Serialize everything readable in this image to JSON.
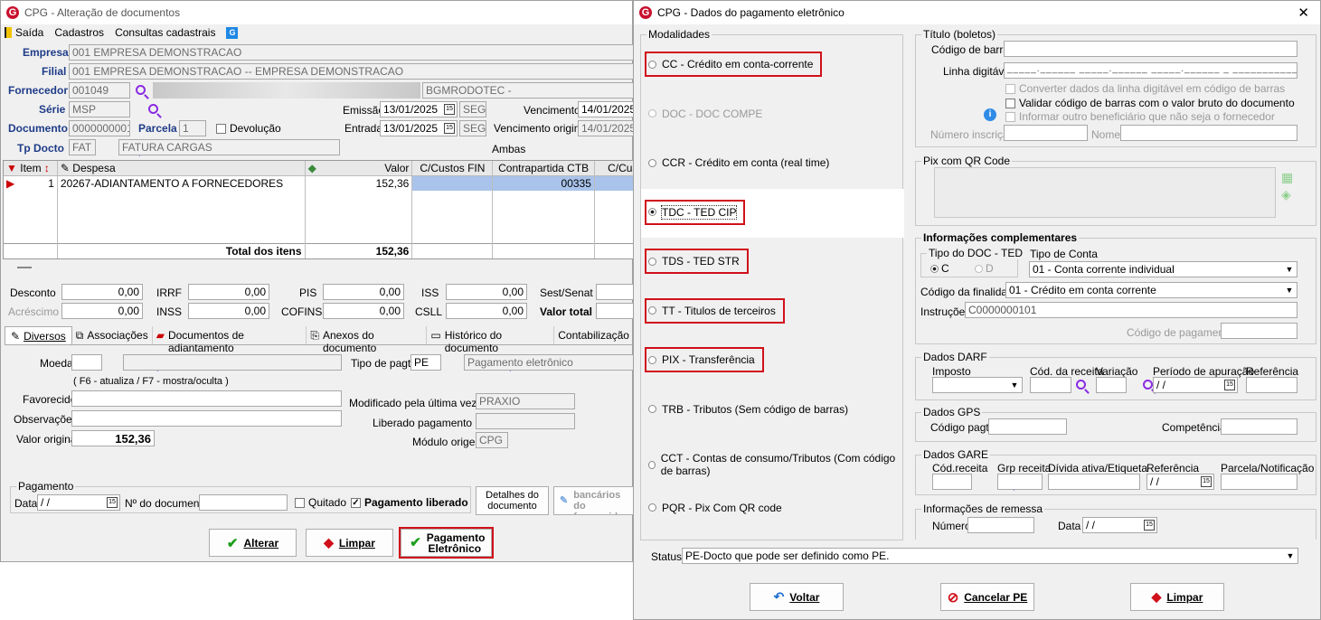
{
  "left": {
    "title": "CPG - Alteração de documentos",
    "menu": [
      "Saída",
      "Cadastros",
      "Consultas cadastrais"
    ],
    "empresa_label": "Empresa",
    "empresa": "001 EMPRESA DEMONSTRACAO",
    "filial_label": "Filial",
    "filial": "001 EMPRESA DEMONSTRACAO -- EMPRESA DEMONSTRACAO",
    "fornecedor_label": "Fornecedor",
    "fornecedor": "001049",
    "fornecedor_nome": "BGMRODOTEC -",
    "serie_label": "Série",
    "serie": "MSP",
    "emissao_label": "Emissão",
    "emissao": "13/01/2025",
    "emissao_dia": "SEG",
    "vencimento_label": "Vencimento",
    "vencimento": "14/01/2025",
    "documento_label": "Documento",
    "documento": "0000000001",
    "parcela_label": "Parcela",
    "parcela": "1",
    "devolucao_label": "Devolução",
    "entrada_label": "Entrada",
    "entrada": "13/01/2025",
    "entrada_dia": "SEG",
    "venc_original_label": "Vencimento original",
    "venc_original": "14/01/2025",
    "tpdocto_label": "Tp Docto",
    "tpdocto": "FAT",
    "tpdocto_nome": "FATURA CARGAS",
    "ambas": "Ambas",
    "grid_headers": [
      "Item",
      "Despesa",
      "Valor",
      "C/Custos FIN",
      "Contrapartida CTB",
      "C/Custos CTB"
    ],
    "grid_row": {
      "item": "1",
      "despesa": "20267-ADIANTAMENTO A FORNECEDORES",
      "valor": "152,36",
      "contrapartida": "00335"
    },
    "total_label": "Total dos itens",
    "total": "152,36",
    "desconto_label": "Desconto",
    "desconto": "0,00",
    "irrf_label": "IRRF",
    "irrf": "0,00",
    "pis_label": "PIS",
    "pis": "0,00",
    "iss_label": "ISS",
    "iss": "0,00",
    "sest_label": "Sest/Senat",
    "acrescimo_label": "Acréscimo",
    "acrescimo": "0,00",
    "inss_label": "INSS",
    "inss": "0,00",
    "cofins_label": "COFINS",
    "cofins": "0,00",
    "csll_label": "CSLL",
    "csll": "0,00",
    "valor_total_label": "Valor total",
    "tabs": [
      "Diversos",
      "Associações",
      "Documentos de adiantamento",
      "Anexos do documento",
      "Histórico do documento",
      "Contabilização"
    ],
    "moeda_label": "Moeda",
    "tipo_pagto_label": "Tipo de pagto",
    "tipo_pagto": "PE",
    "tipo_pagto_nome": "Pagamento eletrônico",
    "f6_hint": "( F6 - atualiza / F7 - mostra/oculta )",
    "favorecido_label": "Favorecido",
    "modificado_label": "Modificado pela última vez por",
    "modificado": "PRAXIO",
    "observacoes_label": "Observações",
    "liberado_label": "Liberado pagamento por",
    "valor_original_label": "Valor original",
    "valor_original": "152,36",
    "modulo_label": "Módulo origem",
    "modulo": "CPG",
    "pagamento_group": "Pagamento",
    "data_label": "Data",
    "data": "/ /",
    "ndoc_label": "Nº do documento",
    "quitado_label": "Quitado",
    "pag_liberado_label": "Pagamento liberado",
    "detalhes_btn": "Detalhes do documento",
    "dados_ban_btn": "Dados bancários do favorecido",
    "alterar_btn": "Alterar",
    "limpar_btn": "Limpar",
    "pag_elet_btn": "Pagamento Eletrônico"
  },
  "right": {
    "title": "CPG - Dados do pagamento eletrônico",
    "modalidades_title": "Modalidades",
    "modalidades": [
      {
        "label": "CC  - Crédito em conta-corrente",
        "enabled": true,
        "selected": false,
        "highlight": true
      },
      {
        "label": "DOC - DOC COMPE",
        "enabled": false,
        "selected": false,
        "highlight": false
      },
      {
        "label": "CCR - Crédito em conta (real time)",
        "enabled": true,
        "selected": false,
        "highlight": false
      },
      {
        "label": "TDC - TED CIP",
        "enabled": true,
        "selected": true,
        "highlight": true
      },
      {
        "label": "TDS - TED STR",
        "enabled": true,
        "selected": false,
        "highlight": true
      },
      {
        "label": "TT  - Titulos de terceiros",
        "enabled": true,
        "selected": false,
        "highlight": true
      },
      {
        "label": "PIX - Transferência",
        "enabled": true,
        "selected": false,
        "highlight": true
      },
      {
        "label": "TRB - Tributos (Sem código de barras)",
        "enabled": true,
        "selected": false,
        "highlight": false
      },
      {
        "label": "CCT - Contas de consumo/Tributos (Com código de barras)",
        "enabled": true,
        "selected": false,
        "highlight": false
      },
      {
        "label": "PQR - Pix Com QR code",
        "enabled": true,
        "selected": false,
        "highlight": false
      }
    ],
    "titulo_group": "Título (boletos)",
    "codigo_barras_label": "Código de barras",
    "linha_digitavel_label": "Linha digitável",
    "converter_label": "Converter dados da linha digitável em código de barras",
    "validar_label": "Validar código de barras com o valor bruto do documento",
    "informar_label": "Informar outro beneficiário que não seja o fornecedor",
    "numero_inscricao_label": "Número inscrição",
    "nome_label": "Nome",
    "pix_group": "Pix com QR Code",
    "info_comp_group": "Informações complementares",
    "tipo_doc_ted_group": "Tipo do DOC - TED",
    "tipo_c": "C",
    "tipo_d": "D",
    "tipo_conta_label": "Tipo de Conta",
    "tipo_conta": "01 - Conta corrente individual",
    "codigo_finalidade_label": "Código da finalidade",
    "codigo_finalidade": "01 - Crédito em conta corrente",
    "instrucoes_label": "Instruções",
    "instrucoes": "C0000000101",
    "codigo_pagamento_label": "Código de pagamento",
    "darf_group": "Dados DARF",
    "darf_headers": [
      "Imposto",
      "Cód. da receita",
      "Variação",
      "Período de apuração",
      "Referência"
    ],
    "darf_periodo": "/ /",
    "gps_group": "Dados GPS",
    "codigo_pagto_label": "Código pagto",
    "competencia_label": "Competência",
    "gare_group": "Dados GARE",
    "gare_headers": [
      "Cód.receita",
      "Grp receita",
      "Dívida ativa/Etiqueta",
      "Referência",
      "Parcela/Notificação"
    ],
    "gare_ref": "/ /",
    "remessa_group": "Informações de remessa",
    "numero_label": "Número",
    "data_label": "Data",
    "data": "/ /",
    "status_label": "Status",
    "status": "PE-Docto  que pode ser definido como PE.",
    "voltar_btn": "Voltar",
    "cancelar_btn": "Cancelar PE",
    "limpar_btn": "Limpar"
  }
}
